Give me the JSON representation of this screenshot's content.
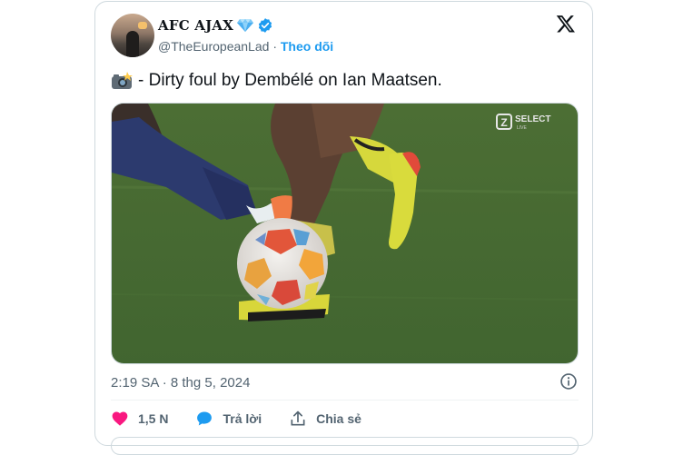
{
  "tweet": {
    "author_name": "AFC AJAX",
    "handle": "@TheEuropeanLad",
    "separator": "·",
    "follow_label": "Theo dõi",
    "text": "- Dirty foul by Dembélé on Ian Maatsen.",
    "timestamp": "2:19 SA · 8 thg 5, 2024"
  },
  "media": {
    "broadcaster_logo_letter": "Z",
    "broadcaster_logo_text": "SELECT",
    "broadcaster_logo_subtext": "LIVE"
  },
  "actions": {
    "likes": "1,5 N",
    "reply_label": "Trả lời",
    "share_label": "Chia sẻ"
  },
  "colors": {
    "accent": "#1d9bf0",
    "like": "#f91880",
    "text": "#0f1419",
    "muted": "#536471",
    "verified": "#1d9bf0"
  },
  "icons": {
    "badge": "gem-icon",
    "verified": "verified-badge-icon",
    "logo": "x-logo-icon",
    "emoji": "camera-flash-icon",
    "info": "info-icon",
    "like": "heart-icon",
    "reply": "speech-bubble-icon",
    "share": "share-icon"
  }
}
